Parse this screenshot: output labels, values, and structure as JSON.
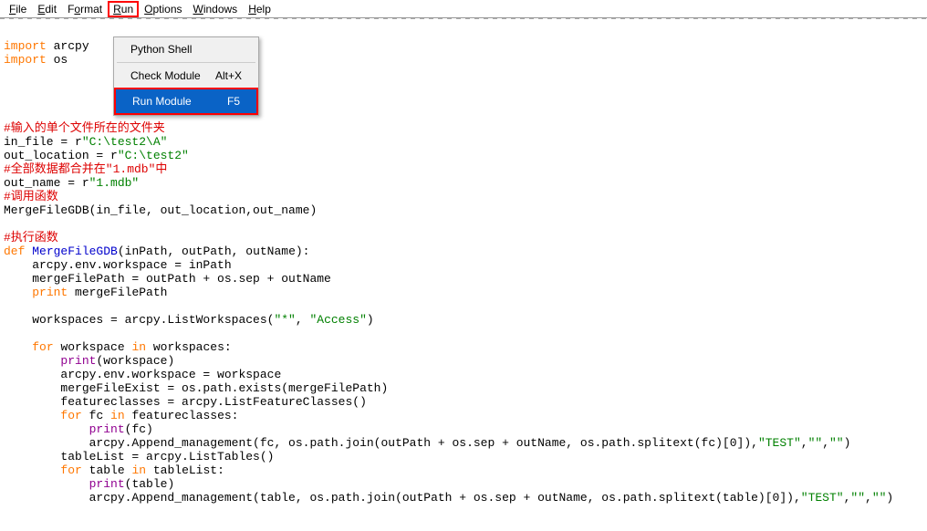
{
  "menubar": {
    "items": [
      {
        "prefix": "F",
        "rest": "ile"
      },
      {
        "prefix": "E",
        "rest": "dit"
      },
      {
        "prefix": "",
        "rest": "F",
        "middle": "o",
        "suffix": "rmat"
      },
      {
        "prefix": "R",
        "rest": "un"
      },
      {
        "prefix": "O",
        "rest": "ptions"
      },
      {
        "prefix": "W",
        "rest": "indows"
      },
      {
        "prefix": "H",
        "rest": "elp"
      }
    ]
  },
  "dropdown": {
    "items": [
      {
        "label": "Python Shell",
        "shortcut": ""
      },
      {
        "label": "Check Module",
        "shortcut": "Alt+X"
      },
      {
        "label": "Run Module",
        "shortcut": "F5"
      }
    ]
  },
  "code": {
    "l1_kw": "import ",
    "l1_mod": "arcpy",
    "l2_kw": "import ",
    "l2_mod": "os",
    "l4_c": "#输入的单个文件所在的文件夹",
    "l5a": "in_file = r",
    "l5b": "\"C:\\test2\\A\"",
    "l6a": "out_location = r",
    "l6b": "\"C:\\test2\"",
    "l7_c": "#全部数据都合并在\"1.mdb\"中",
    "l8a": "out_name = r",
    "l8b": "\"1.mdb\"",
    "l9_c": "#调用函数",
    "l10a": "MergeFileGDB(in_file, out_location,out_name)",
    "l12_c": "#执行函数",
    "l13a": "def ",
    "l13b": "MergeFileGDB",
    "l13c": "(inPath, outPath, outName):",
    "l14": "    arcpy.env.workspace = inPath",
    "l15": "    mergeFilePath = outPath + os.sep + outName",
    "l16a": "    ",
    "l16b": "print ",
    "l16c": "mergeFilePath",
    "l18a": "    workspaces = arcpy.ListWorkspaces(",
    "l18b": "\"*\"",
    "l18c": ", ",
    "l18d": "\"Access\"",
    "l18e": ")",
    "l20a": "    ",
    "l20b": "for ",
    "l20c": "workspace ",
    "l20d": "in ",
    "l20e": "workspaces:",
    "l21a": "        ",
    "l21b": "print",
    "l21c": "(workspace)",
    "l22": "        arcpy.env.workspace = workspace",
    "l23": "        mergeFileExist = os.path.exists(mergeFilePath)",
    "l24": "        featureclasses = arcpy.ListFeatureClasses()",
    "l25a": "        ",
    "l25b": "for ",
    "l25c": "fc ",
    "l25d": "in ",
    "l25e": "featureclasses:",
    "l26a": "            ",
    "l26b": "print",
    "l26c": "(fc)",
    "l27a": "            arcpy.Append_management(fc, os.path.join(outPath + os.sep + outName, os.path.splitext(fc)[",
    "l27b": "0",
    "l27c": "]),",
    "l27d": "\"TEST\"",
    "l27e": ",",
    "l27f": "\"\"",
    "l27g": ",",
    "l27h": "\"\"",
    "l27i": ")",
    "l28": "        tableList = arcpy.ListTables()",
    "l29a": "        ",
    "l29b": "for ",
    "l29c": "table ",
    "l29d": "in ",
    "l29e": "tableList:",
    "l30a": "            ",
    "l30b": "print",
    "l30c": "(table)",
    "l31a": "            arcpy.Append_management(table, os.path.join(outPath + os.sep + outName, os.path.splitext(table)[",
    "l31b": "0",
    "l31c": "]),",
    "l31d": "\"TEST\"",
    "l31e": ",",
    "l31f": "\"\"",
    "l31g": ",",
    "l31h": "\"\"",
    "l31i": ")"
  }
}
